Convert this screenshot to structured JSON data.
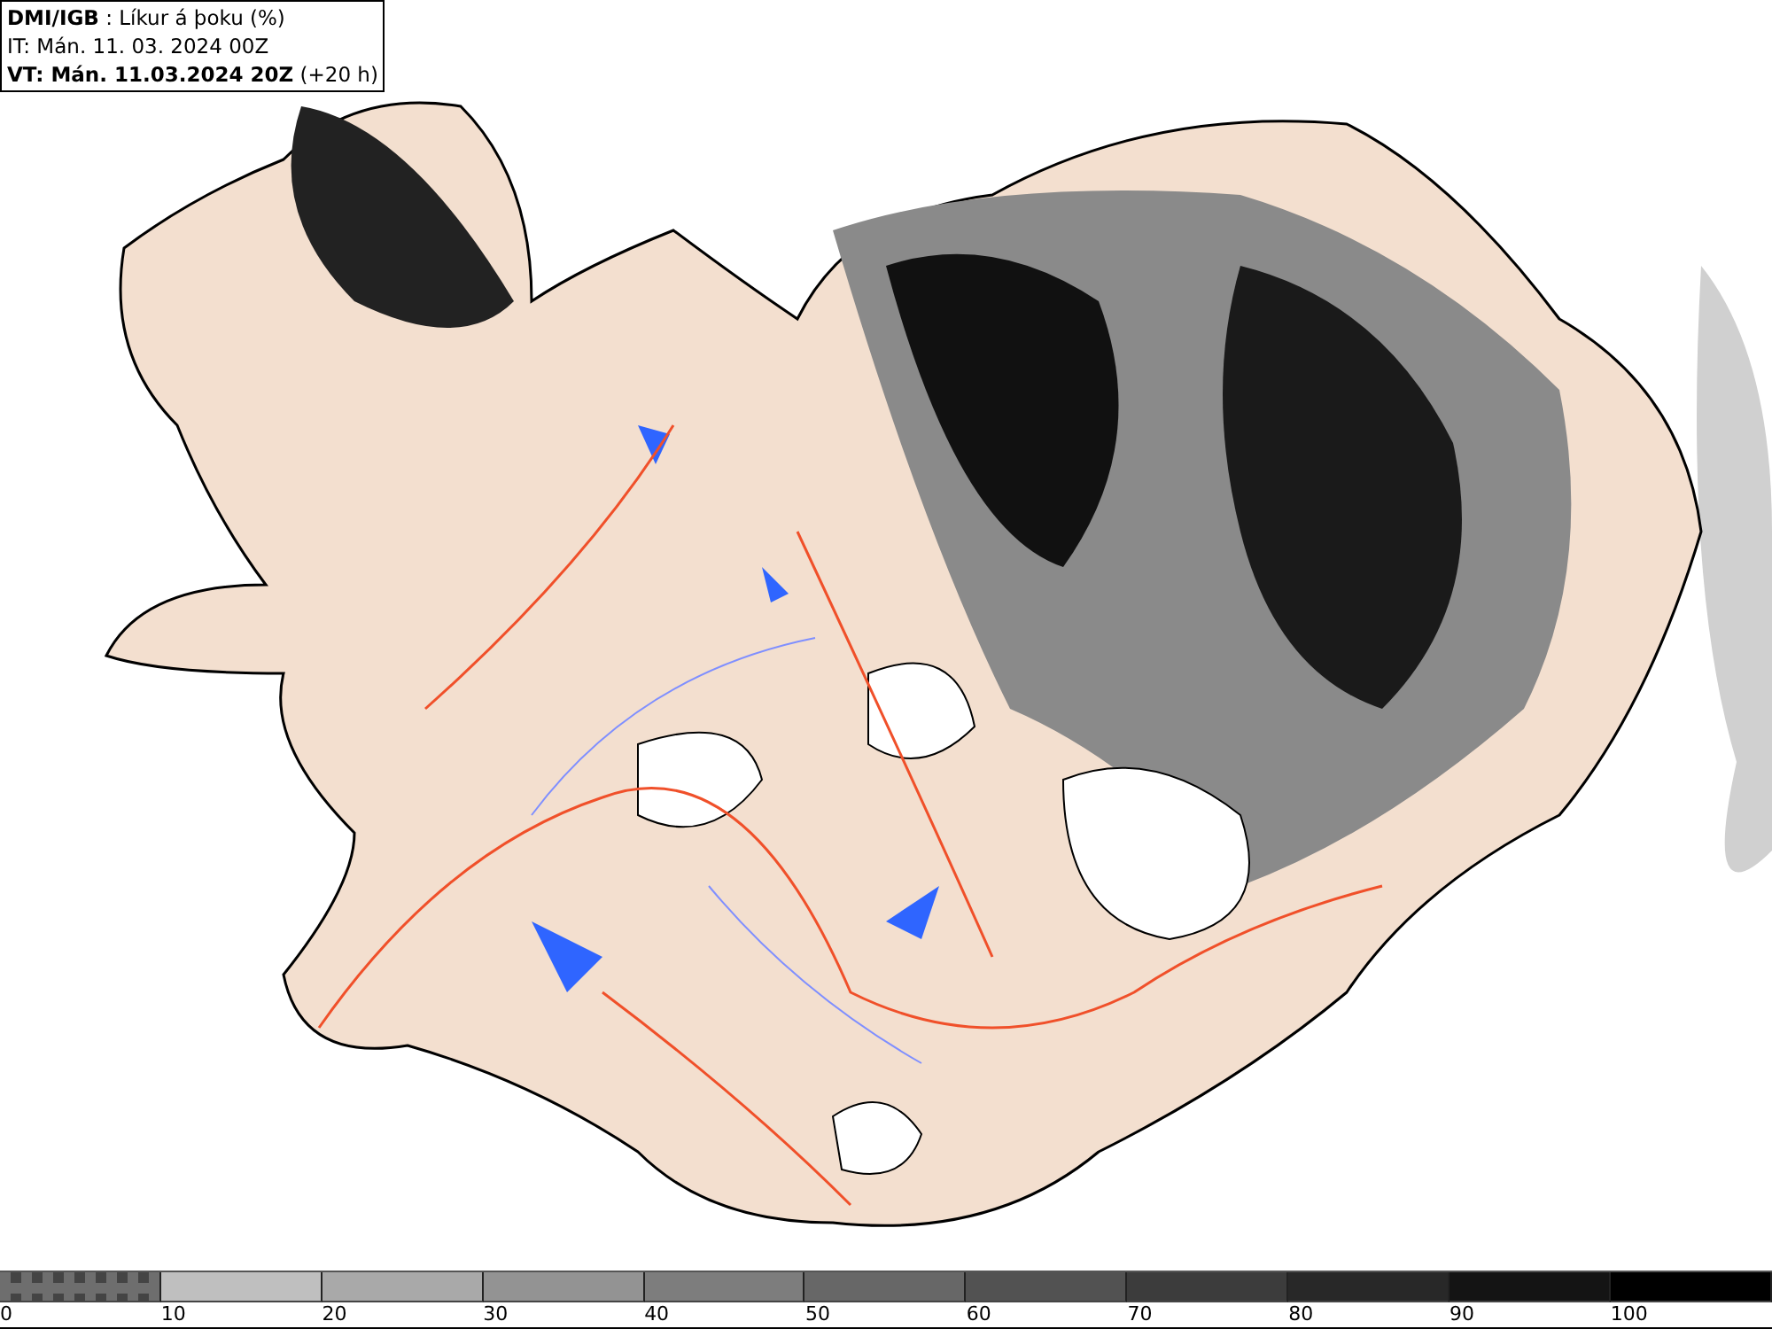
{
  "header": {
    "lines": [
      "**DMI/IGB** : Líkur á þoku (%)",
      "IT: Mán. 11. 03. 2024 00Z",
      "**VT: Mán. 11.03.2024 20Z** (+20 h)"
    ]
  },
  "legend": {
    "segments": [
      {
        "kind": "pattern",
        "color": "#6e6e6e",
        "label": "0"
      },
      {
        "kind": "solid",
        "color": "#bfbfbf",
        "label": "10"
      },
      {
        "kind": "solid",
        "color": "#a9a9a9",
        "label": "20"
      },
      {
        "kind": "solid",
        "color": "#939393",
        "label": "30"
      },
      {
        "kind": "solid",
        "color": "#7d7d7d",
        "label": "40"
      },
      {
        "kind": "solid",
        "color": "#676767",
        "label": "50"
      },
      {
        "kind": "solid",
        "color": "#525252",
        "label": "60"
      },
      {
        "kind": "solid",
        "color": "#3c3c3c",
        "label": "70"
      },
      {
        "kind": "solid",
        "color": "#282828",
        "label": "80"
      },
      {
        "kind": "solid",
        "color": "#141414",
        "label": "90"
      },
      {
        "kind": "solid",
        "color": "#000000",
        "label": "100"
      }
    ]
  }
}
